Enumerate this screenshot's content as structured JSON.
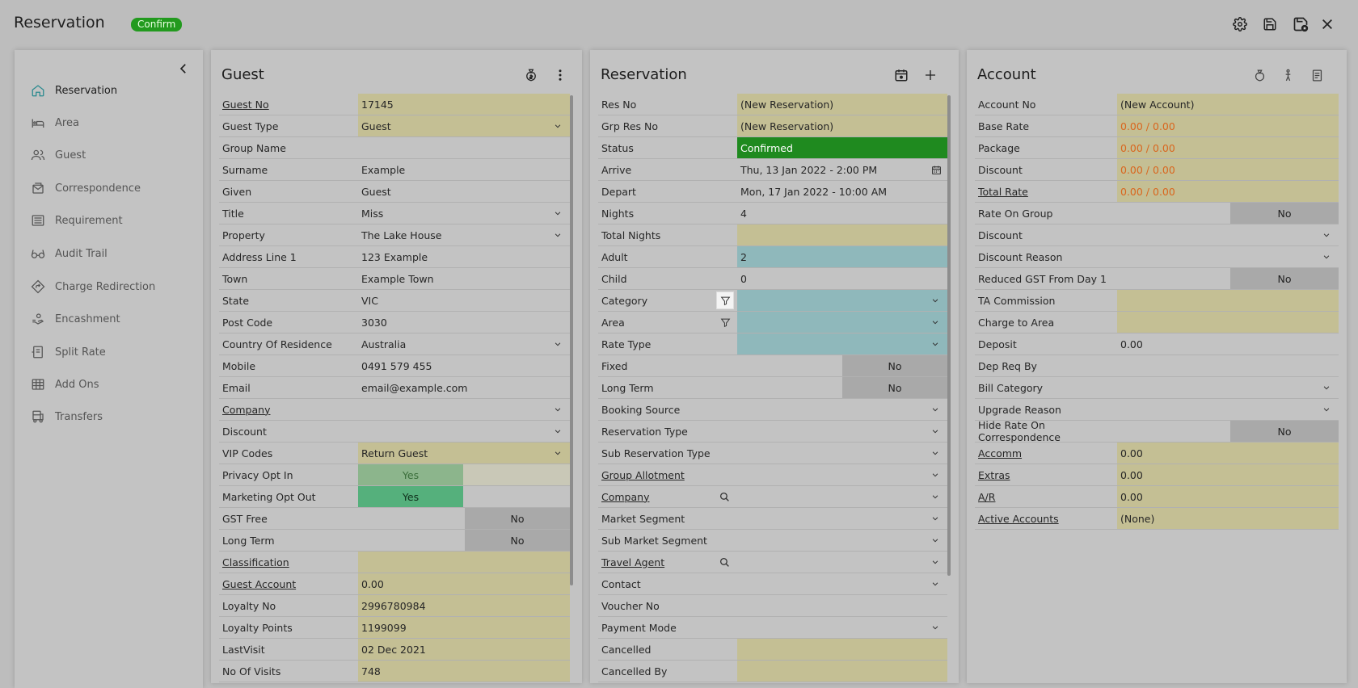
{
  "app": {
    "title": "Reservation",
    "status_badge": "Confirm",
    "status_color": "#229a1e"
  },
  "top_actions": [
    "gear-icon",
    "save-icon",
    "save-close-icon",
    "close-icon"
  ],
  "nav": {
    "items": [
      {
        "label": "Reservation",
        "icon": "home-icon",
        "active": true
      },
      {
        "label": "Area",
        "icon": "bed-icon"
      },
      {
        "label": "Guest",
        "icon": "users-icon"
      },
      {
        "label": "Correspondence",
        "icon": "mail-icon"
      },
      {
        "label": "Requirement",
        "icon": "list-icon"
      },
      {
        "label": "Audit Trail",
        "icon": "glasses-icon"
      },
      {
        "label": "Charge Redirection",
        "icon": "redirect-icon"
      },
      {
        "label": "Encashment",
        "icon": "cash-hand-icon"
      },
      {
        "label": "Split Rate",
        "icon": "split-icon"
      },
      {
        "label": "Add Ons",
        "icon": "grid-icon"
      },
      {
        "label": "Transfers",
        "icon": "bus-icon"
      }
    ]
  },
  "guest": {
    "title": "Guest",
    "rows": [
      {
        "label": "Guest No",
        "value": "17145",
        "link": true,
        "style": "tan"
      },
      {
        "label": "Guest Type",
        "value": "Guest",
        "style": "tan",
        "dropdown": true
      },
      {
        "label": "Group Name",
        "value": ""
      },
      {
        "label": "Surname",
        "value": "Example"
      },
      {
        "label": "Given",
        "value": "Guest"
      },
      {
        "label": "Title",
        "value": "Miss",
        "dropdown": true
      },
      {
        "label": "Property",
        "value": "The Lake House",
        "dropdown": true
      },
      {
        "label": "Address Line 1",
        "value": "123 Example"
      },
      {
        "label": "Town",
        "value": "Example Town"
      },
      {
        "label": "State",
        "value": "VIC"
      },
      {
        "label": "Post Code",
        "value": "3030"
      },
      {
        "label": "Country Of Residence",
        "value": "Australia",
        "dropdown": true
      },
      {
        "label": "Mobile",
        "value": "0491 579 455"
      },
      {
        "label": "Email",
        "value": "email@example.com"
      },
      {
        "label": "Company",
        "value": "",
        "link": true,
        "dropdown": true
      },
      {
        "label": "Discount",
        "value": "",
        "dropdown": true
      },
      {
        "label": "VIP Codes",
        "value": "Return Guest",
        "style": "tan",
        "dropdown": true
      },
      {
        "label": "Privacy Opt In",
        "toggle": "yes-dim",
        "value": "Yes"
      },
      {
        "label": "Marketing Opt Out",
        "toggle": "yes",
        "value": "Yes"
      },
      {
        "label": "GST Free",
        "toggle": "no",
        "value": "No"
      },
      {
        "label": "Long Term",
        "toggle": "no",
        "value": "No"
      },
      {
        "label": "Classification",
        "value": "",
        "link": true,
        "style": "tan"
      },
      {
        "label": "Guest Account",
        "value": "0.00",
        "link": true,
        "style": "tan"
      },
      {
        "label": "Loyalty No",
        "value": "2996780984",
        "style": "tan"
      },
      {
        "label": "Loyalty Points",
        "value": "1199099",
        "style": "tan"
      },
      {
        "label": "LastVisit",
        "value": "02 Dec 2021",
        "style": "tan"
      },
      {
        "label": "No Of Visits",
        "value": "748",
        "style": "tan"
      }
    ]
  },
  "reservation": {
    "title": "Reservation",
    "rows": [
      {
        "label": "Res No",
        "value": "(New Reservation)",
        "style": "tan"
      },
      {
        "label": "Grp Res No",
        "value": "(New Reservation)",
        "style": "tan"
      },
      {
        "label": "Status",
        "value": "Confirmed",
        "style": "green"
      },
      {
        "label": "Arrive",
        "value": "Thu, 13 Jan 2022 - 2:00 PM",
        "calendar": true
      },
      {
        "label": "Depart",
        "value": "Mon, 17 Jan 2022 - 10:00 AM"
      },
      {
        "label": "Nights",
        "value": "4"
      },
      {
        "label": "Total Nights",
        "value": "",
        "style": "tan"
      },
      {
        "label": "Adult",
        "value": "2",
        "style": "teal"
      },
      {
        "label": "Child",
        "value": "0"
      },
      {
        "label": "Category",
        "value": "",
        "style": "teal",
        "dropdown": true,
        "filter": "active"
      },
      {
        "label": "Area",
        "value": "",
        "style": "teal",
        "dropdown": true,
        "filter": "plain"
      },
      {
        "label": "Rate Type",
        "value": "",
        "style": "teal",
        "dropdown": true
      },
      {
        "label": "Fixed",
        "toggle": "no",
        "value": "No"
      },
      {
        "label": "Long Term",
        "toggle": "no",
        "value": "No"
      },
      {
        "label": "Booking Source",
        "value": "",
        "dropdown": true
      },
      {
        "label": "Reservation Type",
        "value": "",
        "dropdown": true
      },
      {
        "label": "Sub Reservation Type",
        "value": "",
        "dropdown": true
      },
      {
        "label": "Group Allotment",
        "value": "",
        "link": true,
        "dropdown": true
      },
      {
        "label": "Company",
        "value": "",
        "link": true,
        "dropdown": true,
        "search": true
      },
      {
        "label": "Market Segment",
        "value": "",
        "dropdown": true
      },
      {
        "label": "Sub Market Segment",
        "value": "",
        "dropdown": true
      },
      {
        "label": "Travel Agent",
        "value": "",
        "link": true,
        "dropdown": true,
        "search": true
      },
      {
        "label": "Contact",
        "value": "",
        "dropdown": true
      },
      {
        "label": "Voucher No",
        "value": ""
      },
      {
        "label": "Payment Mode",
        "value": "",
        "dropdown": true
      },
      {
        "label": "Cancelled",
        "value": "",
        "style": "tan"
      },
      {
        "label": "Cancelled By",
        "value": "",
        "style": "tan"
      }
    ]
  },
  "account": {
    "title": "Account",
    "rows": [
      {
        "label": "Account No",
        "value": "(New Account)",
        "style": "tan"
      },
      {
        "label": "Base Rate",
        "value": "0.00 / 0.00",
        "style": "tan",
        "orange": true
      },
      {
        "label": "Package",
        "value": "0.00 / 0.00",
        "style": "tan",
        "orange": true
      },
      {
        "label": "Discount",
        "value": "0.00 / 0.00",
        "style": "tan",
        "orange": true
      },
      {
        "label": "Total Rate",
        "value": "0.00 / 0.00",
        "style": "tan",
        "orange": true,
        "link": true
      },
      {
        "label": "Rate On Group",
        "toggle": "no",
        "value": "No"
      },
      {
        "label": "Discount",
        "value": "",
        "dropdown": true
      },
      {
        "label": "Discount Reason",
        "value": "",
        "dropdown": true
      },
      {
        "label": "Reduced GST From Day 1",
        "toggle": "no",
        "value": "No"
      },
      {
        "label": "TA Commission",
        "value": "",
        "style": "tan"
      },
      {
        "label": "Charge to Area",
        "value": "",
        "style": "tan"
      },
      {
        "label": "Deposit",
        "value": "0.00"
      },
      {
        "label": "Dep Req By",
        "value": ""
      },
      {
        "label": "Bill Category",
        "value": "",
        "dropdown": true
      },
      {
        "label": "Upgrade Reason",
        "value": "",
        "dropdown": true
      },
      {
        "label": "Hide Rate On Correspondence",
        "toggle": "no",
        "value": "No"
      },
      {
        "label": "Accomm",
        "value": "0.00",
        "style": "tan",
        "link": true
      },
      {
        "label": "Extras",
        "value": "0.00",
        "style": "tan",
        "link": true
      },
      {
        "label": "A/R",
        "value": "0.00",
        "style": "tan",
        "link": true
      },
      {
        "label": "Active Accounts",
        "value": "(None)",
        "style": "tan",
        "link": true
      }
    ]
  }
}
